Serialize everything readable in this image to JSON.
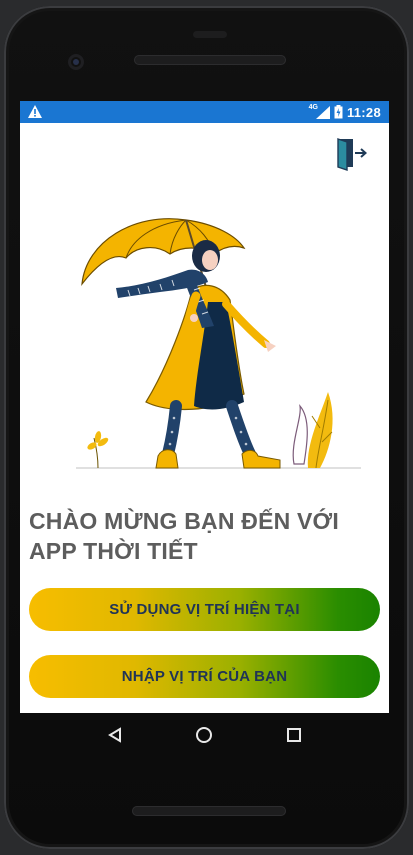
{
  "status_bar": {
    "network": "4G",
    "time": "11:28"
  },
  "app": {
    "welcome_line1": "CHÀO MỪNG BẠN ĐẾN VỚI",
    "welcome_line2": "APP THỜI TIẾT",
    "button_use_location": "SỬ DỤNG VỊ TRÍ HIỆN TẠI",
    "button_enter_location": "NHẬP VỊ TRÍ CỦA BẠN"
  },
  "colors": {
    "status_bar": "#1a76d2",
    "button_gradient_start": "#f7bd00",
    "button_gradient_end": "#1a8300",
    "button_text": "#203456",
    "heading_text": "#5d5d5d"
  },
  "icons": {
    "status_left": "warning-icon",
    "signal": "signal-icon",
    "battery": "battery-icon",
    "exit": "exit-door-icon",
    "nav_back": "back-triangle-icon",
    "nav_home": "home-circle-icon",
    "nav_recents": "recents-square-icon"
  }
}
